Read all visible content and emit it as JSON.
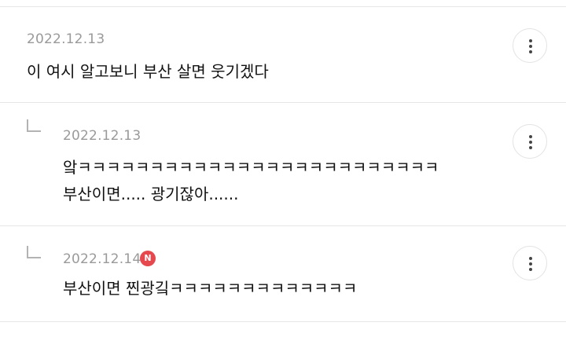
{
  "comments": [
    {
      "date": "2022.12.13",
      "is_reply": false,
      "lines": [
        "이 여시 알고보니 부산 살면 웃기겠다"
      ]
    },
    {
      "date": "2022.12.13",
      "is_reply": true,
      "lines": [
        "앜ㅋㅋㅋㅋㅋㅋㅋㅋㅋㅋㅋㅋㅋㅋㅋㅋㅋㅋㅋㅋㅋㅋㅋㅋㅋ",
        "부산이면..... 광기잖아......"
      ]
    },
    {
      "date": "2022.12.14",
      "is_reply": true,
      "badge": "N",
      "lines": [
        "부산이면 찐광깈ㅋㅋㅋㅋㅋㅋㅋㅋㅋㅋㅋㅋㅋ"
      ]
    }
  ],
  "icons": {
    "more": "more-vertical-icon",
    "reply": "reply-arrow-icon",
    "new": "new-badge-icon"
  },
  "colors": {
    "date": "#9a9a9a",
    "divider": "#e6e6e6",
    "badge": "#e5484d",
    "text": "#111111"
  }
}
